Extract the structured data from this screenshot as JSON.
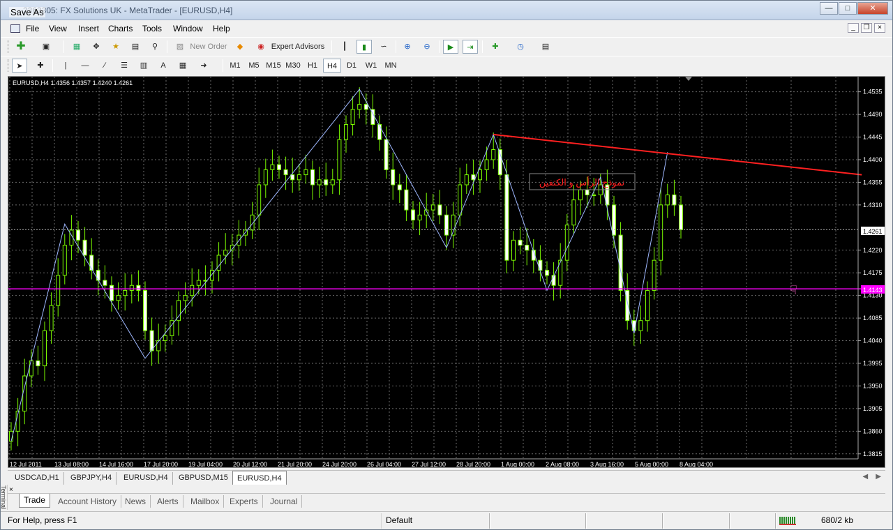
{
  "window": {
    "title": "2363305: FX Solutions UK - MetaTrader - [EURUSD,H4]",
    "dialog_overlay": "Save As",
    "buttons": [
      "minimize",
      "maximize",
      "close"
    ]
  },
  "menu": [
    "File",
    "View",
    "Insert",
    "Charts",
    "Tools",
    "Window",
    "Help"
  ],
  "toolbar1": {
    "new_order_label": "New Order",
    "expert_advisors_label": "Expert Advisors"
  },
  "timeframes": [
    "M1",
    "M5",
    "M15",
    "M30",
    "H1",
    "H4",
    "D1",
    "W1",
    "MN"
  ],
  "selected_timeframe": "H4",
  "chart": {
    "header": "EURUSD,H4  1.4356 1.4357 1.4240 1.4261",
    "annotation": "نموذج الرأس و الكتفين",
    "current_price_label": "1.4261",
    "horizontal_line_label": "1.4143",
    "colors": {
      "background": "#000000",
      "grid": "#6b6b6b",
      "candle": "#7cfc00",
      "zigzag": "#9fb8ff",
      "trendline": "#ff2020",
      "hline": "#ff00ff",
      "text": "#ffffff"
    }
  },
  "chart_data": {
    "type": "candlestick",
    "symbol": "EURUSD",
    "timeframe": "H4",
    "ohlc_current": {
      "open": 1.4356,
      "high": 1.4357,
      "low": 1.424,
      "close": 1.4261
    },
    "price_ticks": [
      "1.4535",
      "1.4490",
      "1.4445",
      "1.4400",
      "1.4355",
      "1.4310",
      "1.4261",
      "1.4220",
      "1.4175",
      "1.4143",
      "1.4130",
      "1.4085",
      "1.4040",
      "1.3995",
      "1.3950",
      "1.3905",
      "1.3860",
      "1.3815"
    ],
    "time_ticks": [
      "12 Jul 2011",
      "13 Jul 08:00",
      "14 Jul 16:00",
      "17 Jul 20:00",
      "19 Jul 04:00",
      "20 Jul 12:00",
      "21 Jul 20:00",
      "24 Jul 20:00",
      "26 Jul 04:00",
      "27 Jul 12:00",
      "28 Jul 20:00",
      "1 Aug 00:00",
      "2 Aug 08:00",
      "3 Aug 16:00",
      "5 Aug 00:00",
      "8 Aug 04:00"
    ],
    "ylim": [
      1.3805,
      1.4565
    ],
    "zigzag": [
      [
        0,
        1.384
      ],
      [
        8,
        1.4272
      ],
      [
        20,
        1.4005
      ],
      [
        52,
        1.454
      ],
      [
        65,
        1.4225
      ],
      [
        72,
        1.445
      ],
      [
        80,
        1.414
      ],
      [
        88,
        1.4365
      ],
      [
        93,
        1.4055
      ],
      [
        98,
        1.4415
      ]
    ],
    "trendline": {
      "from": [
        72,
        1.445
      ],
      "to": [
        127,
        1.437
      ]
    },
    "hline": 1.4143,
    "closes": [
      1.386,
      1.39,
      1.397,
      1.4,
      1.399,
      1.406,
      1.411,
      1.417,
      1.423,
      1.426,
      1.424,
      1.421,
      1.418,
      1.416,
      1.415,
      1.412,
      1.413,
      1.414,
      1.415,
      1.414,
      1.406,
      1.402,
      1.404,
      1.405,
      1.408,
      1.412,
      1.413,
      1.415,
      1.416,
      1.416,
      1.418,
      1.421,
      1.422,
      1.423,
      1.425,
      1.426,
      1.429,
      1.435,
      1.438,
      1.439,
      1.438,
      1.437,
      1.436,
      1.437,
      1.438,
      1.435,
      1.436,
      1.435,
      1.436,
      1.444,
      1.447,
      1.45,
      1.451,
      1.45,
      1.447,
      1.444,
      1.438,
      1.435,
      1.434,
      1.43,
      1.428,
      1.429,
      1.43,
      1.431,
      1.429,
      1.425,
      1.429,
      1.435,
      1.437,
      1.436,
      1.438,
      1.44,
      1.442,
      1.437,
      1.42,
      1.424,
      1.423,
      1.422,
      1.42,
      1.418,
      1.417,
      1.415,
      1.42,
      1.427,
      1.432,
      1.434,
      1.433,
      1.433,
      1.435,
      1.431,
      1.425,
      1.414,
      1.408,
      1.406,
      1.408,
      1.414,
      1.42,
      1.431,
      1.433,
      1.431,
      1.4261
    ]
  },
  "chart_tabs": [
    "USDCAD,H1",
    "GBPJPY,H4",
    "EURUSD,H4",
    "GBPUSD,M15",
    "EURUSD,H4"
  ],
  "active_chart_tab": 4,
  "terminal_tabs": [
    "Trade",
    "Account History",
    "News",
    "Alerts",
    "Mailbox",
    "Experts",
    "Journal"
  ],
  "terminal_side_label": "Terminal",
  "status": {
    "help": "For Help, press F1",
    "profile": "Default",
    "traffic": "680/2 kb"
  }
}
